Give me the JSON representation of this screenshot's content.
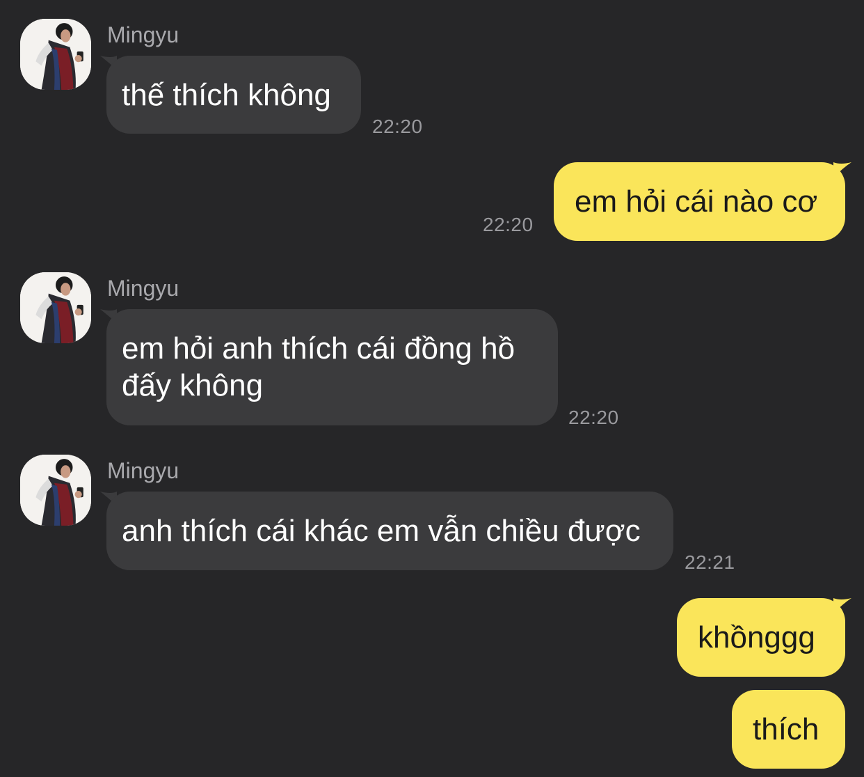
{
  "messages": [
    {
      "sender": "Mingyu",
      "text": "thế thích không",
      "time": "22:20"
    },
    {
      "text": "em hỏi cái nào cơ",
      "time": "22:20"
    },
    {
      "sender": "Mingyu",
      "text": "em hỏi anh thích cái đồng hồ đấy không",
      "time": "22:20"
    },
    {
      "sender": "Mingyu",
      "text": "anh thích cái khác em vẫn chiều được",
      "time": "22:21"
    },
    {
      "text": "khồnggg"
    },
    {
      "text": "thích"
    }
  ],
  "colors": {
    "background": "#262628",
    "incoming_bubble": "#3b3b3d",
    "outgoing_bubble": "#fae55a"
  },
  "icons": {
    "avatar": "profile-photo"
  }
}
